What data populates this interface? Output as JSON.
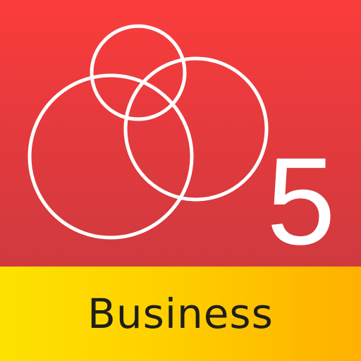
{
  "icon": {
    "version_number": "5",
    "edition_label": "Business",
    "symbol": "overlapping-circles-icon"
  },
  "colors": {
    "top_gradient": [
      "#fb3c3c",
      "#cf3a3e"
    ],
    "bottom_gradient": [
      "#fde200",
      "#ffb000"
    ],
    "circle_stroke": "#ffffff",
    "label_text": "#1e1e1e"
  }
}
